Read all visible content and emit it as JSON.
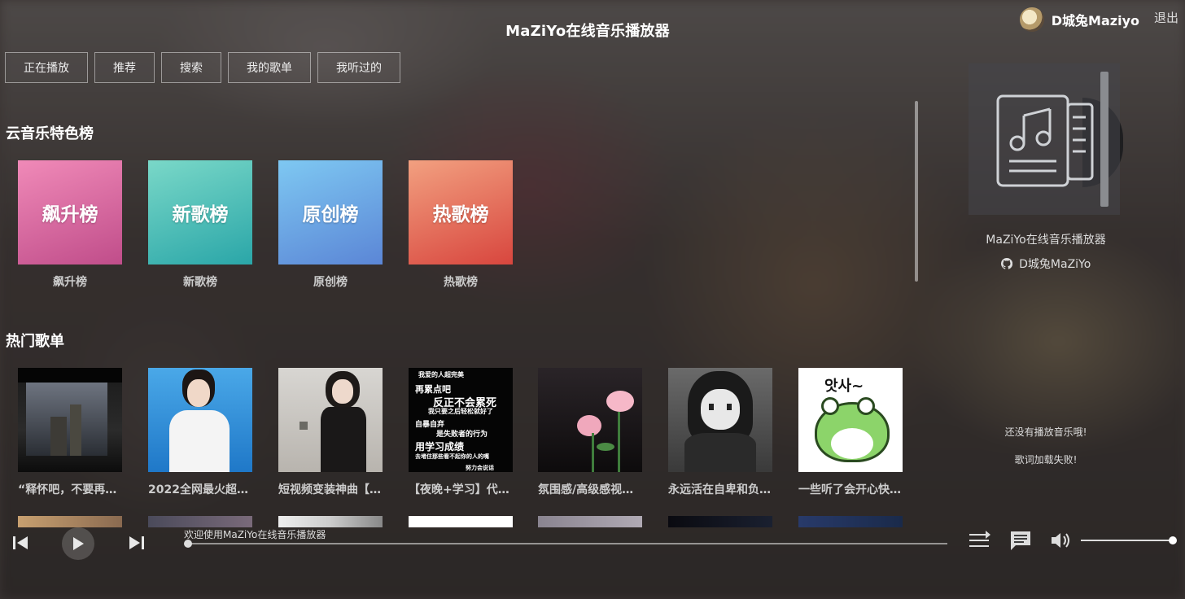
{
  "app": {
    "title": "MaZiYo在线音乐播放器"
  },
  "user": {
    "name": "D城兔Maziyo",
    "logout": "退出"
  },
  "tabs": [
    "正在播放",
    "推荐",
    "搜索",
    "我的歌单",
    "我听过的"
  ],
  "sections": {
    "charts_title": "云音乐特色榜",
    "playlists_title": "热门歌单"
  },
  "charts": [
    {
      "cover_text": "飙升榜",
      "name": "飙升榜",
      "gradient": [
        "#f08ab8",
        "#c04d8a"
      ]
    },
    {
      "cover_text": "新歌榜",
      "name": "新歌榜",
      "gradient": [
        "#7ad8c8",
        "#2aa6a8"
      ]
    },
    {
      "cover_text": "原创榜",
      "name": "原创榜",
      "gradient": [
        "#7ec8f2",
        "#5b86d6"
      ]
    },
    {
      "cover_text": "热歌榜",
      "name": "热歌榜",
      "gradient": [
        "#f2a080",
        "#d8463e"
      ]
    }
  ],
  "playlists": [
    {
      "name": "“释怀吧，不要再…"
    },
    {
      "name": "2022全网最火超…"
    },
    {
      "name": "短视频变装神曲【…"
    },
    {
      "name": "【夜晚+学习】代…"
    },
    {
      "name": "氛围感/高级感视…"
    },
    {
      "name": "永远活在自卑和负…"
    },
    {
      "name": "一些听了会开心快…"
    }
  ],
  "cover4_text": {
    "l1": "我爱的人超完美",
    "l2": "再累点吧",
    "l3": "反正不会累死",
    "l4": "我只要之后轻松就好了",
    "l5": "自暴自弃",
    "l6": "是失败者的行为",
    "l7": "用学习成绩",
    "l8": "去堵住那些看不起你的人的嘴",
    "l9": "努力会说话"
  },
  "cover7_text": "앗사~",
  "right_panel": {
    "title": "MaZiYo在线音乐播放器",
    "author": "D城兔MaZiYo",
    "no_music": "还没有播放音乐哦!",
    "lyric_failed": "歌词加载失败!"
  },
  "player": {
    "status": "欢迎使用MaZiYo在线音乐播放器",
    "progress": 0,
    "volume": 1.0
  }
}
